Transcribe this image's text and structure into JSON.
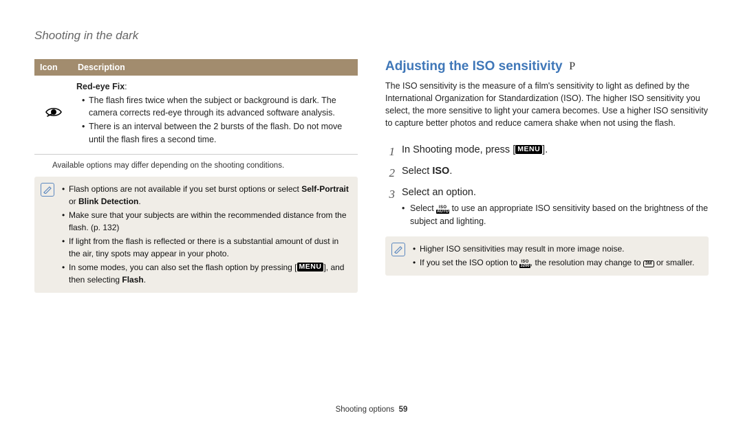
{
  "header": {
    "title": "Shooting in the dark"
  },
  "table": {
    "col_icon": "Icon",
    "col_desc": "Description",
    "row": {
      "title": "Red-eye Fix",
      "b1": "The flash fires twice when the subject or background is dark. The camera corrects red-eye through its advanced software analysis.",
      "b2": "There is an interval between the 2 bursts of the flash. Do not move until the flash fires a second time."
    }
  },
  "caption": "Available options may differ depending on the shooting conditions.",
  "note_left": {
    "b1_pre": "Flash options are not available if you set burst options or select ",
    "b1_bold1": "Self-Portrait",
    "b1_mid": " or ",
    "b1_bold2": "Blink Detection",
    "b1_post": ".",
    "b2": "Make sure that your subjects are within the recommended distance from the flash. (p. 132)",
    "b3": "If light from the flash is reflected or there is a substantial amount of dust in the air, tiny spots may appear in your photo.",
    "b4_pre": "In some modes, you can also set the flash option by pressing [",
    "b4_menu": "MENU",
    "b4_mid": "], and then selecting ",
    "b4_bold": "Flash",
    "b4_post": "."
  },
  "right": {
    "heading": "Adjusting the ISO sensitivity",
    "mode": "P",
    "intro": "The ISO sensitivity is the measure of a film's sensitivity to light as defined by the International Organization for Standardization (ISO). The higher ISO sensitivity you select, the more sensitive to light your camera becomes. Use a higher ISO sensitivity to capture better photos and reduce camera shake when not using the flash.",
    "step1_pre": "In Shooting mode, press [",
    "step1_menu": "MENU",
    "step1_post": "].",
    "step2_pre": "Select ",
    "step2_bold": "ISO",
    "step2_post": ".",
    "step3": "Select an option.",
    "step3_sub_pre": "Select ",
    "step3_sub_post": " to use an appropriate ISO sensitivity based on the brightness of the subject and lighting.",
    "iso_top": "ISO",
    "iso_bot": "AUTO"
  },
  "note_right": {
    "b1": "Higher ISO sensitivities may result in more image noise.",
    "b2_pre": "If you set the ISO option to ",
    "b2_mid": ", the resolution may change to ",
    "b2_res": "3M",
    "b2_post": " or smaller.",
    "iso_top": "ISO",
    "iso_bot": "3200"
  },
  "footer": {
    "section": "Shooting options",
    "page": "59"
  }
}
